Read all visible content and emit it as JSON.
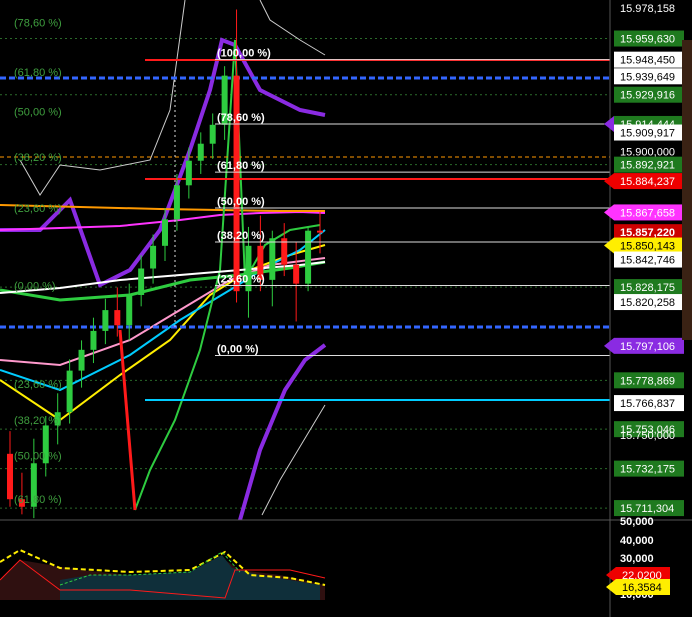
{
  "chart_data": {
    "type": "candlestick",
    "ylim": [
      15705.0,
      15980.0
    ],
    "x_count": 46,
    "candles": [
      {
        "o": 15740,
        "h": 15752,
        "l": 15712,
        "c": 15716
      },
      {
        "o": 15716,
        "h": 15730,
        "l": 15708,
        "c": 15712
      },
      {
        "o": 15712,
        "h": 15748,
        "l": 15706,
        "c": 15735
      },
      {
        "o": 15735,
        "h": 15760,
        "l": 15728,
        "c": 15755
      },
      {
        "o": 15755,
        "h": 15772,
        "l": 15745,
        "c": 15762
      },
      {
        "o": 15762,
        "h": 15790,
        "l": 15756,
        "c": 15784
      },
      {
        "o": 15784,
        "h": 15800,
        "l": 15775,
        "c": 15795
      },
      {
        "o": 15795,
        "h": 15812,
        "l": 15788,
        "c": 15805
      },
      {
        "o": 15805,
        "h": 15822,
        "l": 15798,
        "c": 15816
      },
      {
        "o": 15816,
        "h": 15828,
        "l": 15802,
        "c": 15808
      },
      {
        "o": 15808,
        "h": 15830,
        "l": 15800,
        "c": 15824
      },
      {
        "o": 15824,
        "h": 15845,
        "l": 15818,
        "c": 15838
      },
      {
        "o": 15838,
        "h": 15856,
        "l": 15830,
        "c": 15850
      },
      {
        "o": 15850,
        "h": 15870,
        "l": 15842,
        "c": 15864
      },
      {
        "o": 15864,
        "h": 15888,
        "l": 15858,
        "c": 15882
      },
      {
        "o": 15882,
        "h": 15902,
        "l": 15875,
        "c": 15895
      },
      {
        "o": 15895,
        "h": 15910,
        "l": 15888,
        "c": 15904
      },
      {
        "o": 15904,
        "h": 15920,
        "l": 15896,
        "c": 15914
      },
      {
        "o": 15914,
        "h": 15945,
        "l": 15906,
        "c": 15940
      },
      {
        "o": 15940,
        "h": 15975,
        "l": 15820,
        "c": 15826
      },
      {
        "o": 15826,
        "h": 15860,
        "l": 15812,
        "c": 15850
      },
      {
        "o": 15850,
        "h": 15866,
        "l": 15826,
        "c": 15832
      },
      {
        "o": 15832,
        "h": 15858,
        "l": 15818,
        "c": 15854
      },
      {
        "o": 15854,
        "h": 15862,
        "l": 15834,
        "c": 15840
      },
      {
        "o": 15840,
        "h": 15852,
        "l": 15810,
        "c": 15830
      },
      {
        "o": 15830,
        "h": 15860,
        "l": 15826,
        "c": 15858
      },
      {
        "o": 15858,
        "h": 15868,
        "l": 15846,
        "c": 15857
      }
    ],
    "prices": [
      {
        "label": "15.959,630",
        "value": 15959.63,
        "kind": "green"
      },
      {
        "label": "15.948,450",
        "value": 15948.45,
        "kind": "white"
      },
      {
        "label": "15.939,649",
        "value": 15939.649,
        "kind": "white"
      },
      {
        "label": "15.929,916",
        "value": 15929.916,
        "kind": "green"
      },
      {
        "label": "15.914,444",
        "value": 15914.444,
        "kind": "purple-green"
      },
      {
        "label": "15.909,917",
        "value": 15909.917,
        "kind": "white"
      },
      {
        "label": "15.900,000",
        "value": 15900.0,
        "kind": "plain"
      },
      {
        "label": "15.892,921",
        "value": 15892.921,
        "kind": "green"
      },
      {
        "label": "15.884,237",
        "value": 15884.237,
        "kind": "red"
      },
      {
        "label": "15.867,658",
        "value": 15867.658,
        "kind": "magenta"
      },
      {
        "label": "15.857,220",
        "value": 15857.22,
        "kind": "darkred"
      },
      {
        "label": "15.850,143",
        "value": 15850.143,
        "kind": "yellow"
      },
      {
        "label": "15.842,746",
        "value": 15842.746,
        "kind": "white"
      },
      {
        "label": "15.828,175",
        "value": 15828.175,
        "kind": "green"
      },
      {
        "label": "15.820,258",
        "value": 15820.258,
        "kind": "white"
      },
      {
        "label": "15.797,106",
        "value": 15797.106,
        "kind": "purple"
      },
      {
        "label": "15.778,869",
        "value": 15778.869,
        "kind": "green"
      },
      {
        "label": "15.766,837",
        "value": 15766.837,
        "kind": "white"
      },
      {
        "label": "15.753,046",
        "value": 15753.046,
        "kind": "green"
      },
      {
        "label": "15.750,000",
        "value": 15750.0,
        "kind": "plain"
      },
      {
        "label": "15.732,175",
        "value": 15732.175,
        "kind": "green"
      },
      {
        "label": "15.711,304",
        "value": 15711.304,
        "kind": "green"
      },
      {
        "label": "15.978,158",
        "value": 15978.158,
        "kind": "plain"
      }
    ],
    "fib_right": [
      {
        "label": "(100,00 %)",
        "value": 15948.45
      },
      {
        "label": "(78,60 %)",
        "value": 15914.444
      },
      {
        "label": "(61,80 %)",
        "value": 15889.0
      },
      {
        "label": "(50,00 %)",
        "value": 15870.0
      },
      {
        "label": "(38,20 %)",
        "value": 15852.0
      },
      {
        "label": "(23,60 %)",
        "value": 15829.0
      },
      {
        "label": "(0,00 %)",
        "value": 15792.0
      }
    ],
    "fib_left": [
      {
        "label": "(78,60 %)",
        "value": 15968.0
      },
      {
        "label": "(61,80 %)",
        "value": 15942.0
      },
      {
        "label": "(50,00 %)",
        "value": 15921.0
      },
      {
        "label": "(38,20 %)",
        "value": 15897.0
      },
      {
        "label": "(23,60 %)",
        "value": 15870.0
      },
      {
        "label": "(0,00 %)",
        "value": 15829.0
      },
      {
        "label": "(23,60 %)",
        "value": 15777.0
      },
      {
        "label": "(38,20 %)",
        "value": 15758.0
      },
      {
        "label": "(50,00 %)",
        "value": 15739.0
      },
      {
        "label": "(61,80 %)",
        "value": 15716.0
      }
    ],
    "lower_scale": [
      "50,000",
      "40,000",
      "30,000",
      "10,000"
    ],
    "lower_tags": [
      {
        "label": "22,0200",
        "kind": "red"
      },
      {
        "label": "16,3584",
        "kind": "yellow"
      }
    ],
    "colors": {
      "up": "#2ecc40",
      "down": "#ff1a1a",
      "purple": "#8a2be2",
      "magenta": "#ff33ff",
      "yellow": "#ffee00",
      "cyan": "#00ccff",
      "orange": "#ff9900",
      "blue": "#3366ff",
      "white": "#ffffff",
      "darkred": "#cc0000",
      "pink": "#ff99cc"
    }
  }
}
